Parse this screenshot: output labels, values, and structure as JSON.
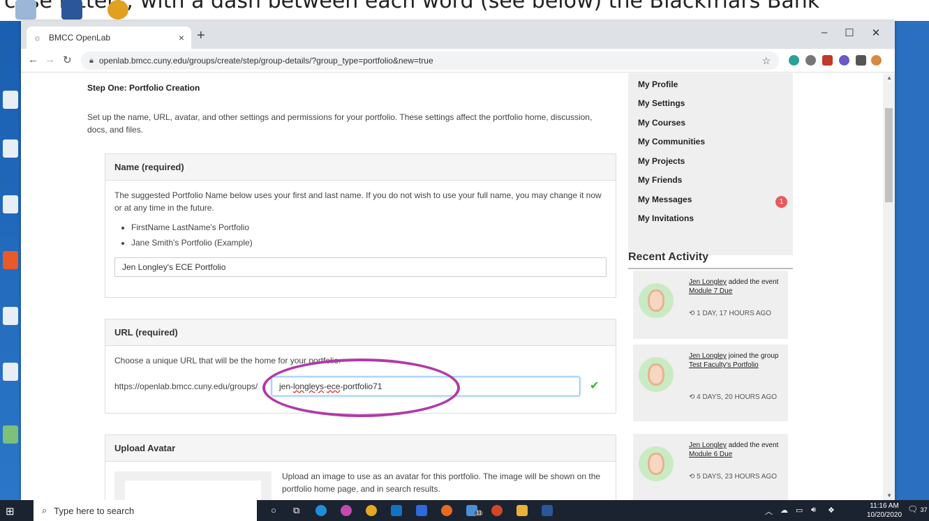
{
  "doc_strip": {
    "text": "case letters; with a dash between each word (see below) the Blackfriars Bank"
  },
  "browser": {
    "tab_title": "BMCC OpenLab",
    "url": "openlab.bmcc.cuny.edu/groups/create/step/group-details/?group_type=portfolio&new=true"
  },
  "page": {
    "step_title": "Step One: Portfolio Creation",
    "step_desc": "Set up the name, URL, avatar, and other settings and permissions for your portfolio. These settings affect the portfolio home, discussion, docs, and files.",
    "name_panel": {
      "heading": "Name (required)",
      "desc": "The suggested Portfolio Name below uses your first and last name. If you do not wish to use your full name, you may change it now or at any time in the future.",
      "bullets": [
        "FirstName LastName's Portfolio",
        "Jane Smith's Portfolio (Example)"
      ],
      "value": "Jen Longley's ECE Portfolio"
    },
    "url_panel": {
      "heading": "URL (required)",
      "desc": "Choose a unique URL that will be the home for your portfolio.",
      "prefix": "https://openlab.bmcc.cuny.edu/groups/",
      "value_part1": "jen-",
      "value_part2": "longleys",
      "value_part3": "-",
      "value_part4": "ece",
      "value_part5": "-portfolio71"
    },
    "avatar_panel": {
      "heading": "Upload Avatar",
      "desc": "Upload an image to use as an avatar for this portfolio. The image will be shown on the portfolio home page, and in search results."
    }
  },
  "sidebar": {
    "items": [
      "My Profile",
      "My Settings",
      "My Courses",
      "My Communities",
      "My Projects",
      "My Friends",
      "My Messages",
      "My Invitations"
    ],
    "messages_badge": "1",
    "recent_title": "Recent Activity",
    "activities": [
      {
        "user": "Jen Longley",
        "action": " added the event ",
        "target": "Module 7 Due",
        "time": "1 DAY, 17 HOURS AGO"
      },
      {
        "user": "Jen Longley",
        "action": " joined the group ",
        "target": "Test Faculty's Portfolio",
        "time": "4 DAYS, 20 HOURS AGO"
      },
      {
        "user": "Jen Longley",
        "action": " added the event ",
        "target": "Module 6 Due",
        "time": "5 DAYS, 23 HOURS AGO"
      }
    ]
  },
  "taskbar": {
    "search_placeholder": "Type here to search",
    "time": "11:16 AM",
    "date": "10/20/2020",
    "notifications": "37",
    "outlook_badge": "11"
  },
  "colors": {
    "accent": "#b03aa8",
    "badge": "#e85a5a",
    "check": "#2eb82e",
    "taskbar": "#1b2330"
  }
}
